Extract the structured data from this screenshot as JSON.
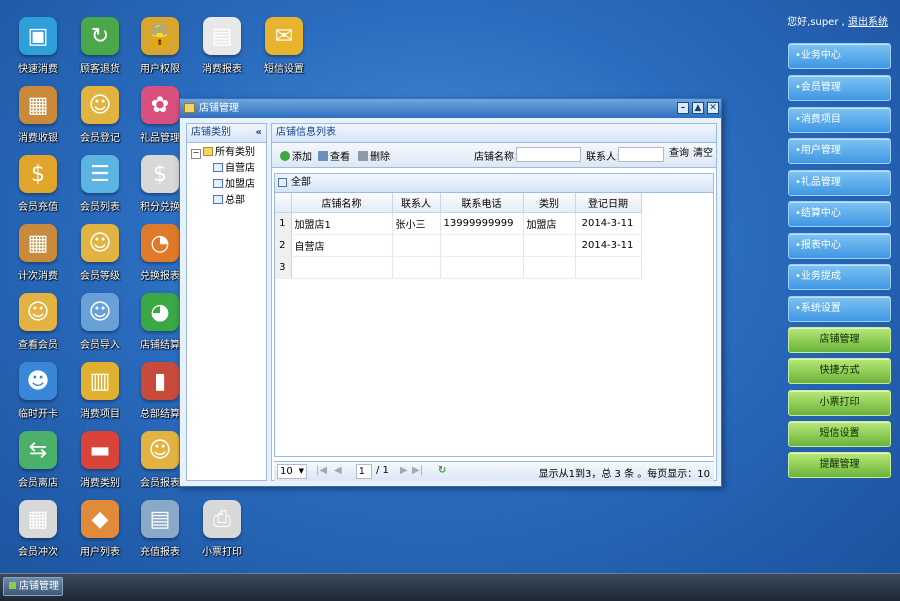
{
  "desktop": {
    "icons": [
      {
        "label": "快速消费",
        "icon": "fast-consume-icon",
        "glyph": "▣",
        "bg": "#2e9fd8"
      },
      {
        "label": "顾客退货",
        "icon": "return-goods-icon",
        "glyph": "↻",
        "bg": "#4aa84a"
      },
      {
        "label": "用户权限",
        "icon": "user-permission-icon",
        "glyph": "🔒",
        "bg": "#d9a531"
      },
      {
        "label": "消费报表",
        "icon": "consume-report-icon",
        "glyph": "▤",
        "bg": "#e8e8e8"
      },
      {
        "label": "短信设置",
        "icon": "sms-settings-icon",
        "glyph": "✉",
        "bg": "#e8b32d"
      },
      {
        "label": "消费收银",
        "icon": "cashier-icon",
        "glyph": "▦",
        "bg": "#c98a3b"
      },
      {
        "label": "会员登记",
        "icon": "member-register-icon",
        "glyph": "☺",
        "bg": "#e2b340"
      },
      {
        "label": "礼品管理",
        "icon": "gift-icon",
        "glyph": "✿",
        "bg": "#d94f7e"
      },
      {
        "label": "会员充值",
        "icon": "member-recharge-icon",
        "glyph": "$",
        "bg": "#e0a52a"
      },
      {
        "label": "会员列表",
        "icon": "member-list-icon",
        "glyph": "☰",
        "bg": "#5bb5e0"
      },
      {
        "label": "积分兑换",
        "icon": "points-exchange-icon",
        "glyph": "$",
        "bg": "#d8d8d8"
      },
      {
        "label": "计次消费",
        "icon": "count-consume-icon",
        "glyph": "▦",
        "bg": "#c98a3b"
      },
      {
        "label": "会员等级",
        "icon": "member-level-icon",
        "glyph": "☺",
        "bg": "#e2b340"
      },
      {
        "label": "兑换报表",
        "icon": "exchange-report-icon",
        "glyph": "◔",
        "bg": "#e07a2a"
      },
      {
        "label": "查看会员",
        "icon": "view-member-icon",
        "glyph": "☺",
        "bg": "#e2b340"
      },
      {
        "label": "会员导入",
        "icon": "member-import-icon",
        "glyph": "☺",
        "bg": "#6aa0d8"
      },
      {
        "label": "店铺结算",
        "icon": "store-settle-icon",
        "glyph": "◕",
        "bg": "#39a845"
      },
      {
        "label": "临时开卡",
        "icon": "temp-card-icon",
        "glyph": "☻",
        "bg": "#3a86d8"
      },
      {
        "label": "消费项目",
        "icon": "consume-item-icon",
        "glyph": "▥",
        "bg": "#e0b030"
      },
      {
        "label": "总部结算",
        "icon": "hq-settle-icon",
        "glyph": "▮",
        "bg": "#c84a3a"
      },
      {
        "label": "会员离店",
        "icon": "member-leave-icon",
        "glyph": "⇆",
        "bg": "#4ab06a"
      },
      {
        "label": "消费类别",
        "icon": "consume-category-icon",
        "glyph": "▬",
        "bg": "#d9433a"
      },
      {
        "label": "会员报表",
        "icon": "member-report-icon",
        "glyph": "☺",
        "bg": "#e2b340"
      },
      {
        "label": "会员冲次",
        "icon": "member-redo-icon",
        "glyph": "▦",
        "bg": "#d8d8d8"
      },
      {
        "label": "用户列表",
        "icon": "user-list-icon",
        "glyph": "◆",
        "bg": "#e08a3a"
      },
      {
        "label": "充值报表",
        "icon": "recharge-report-icon",
        "glyph": "▤",
        "bg": "#8aa8c8"
      },
      {
        "label": "小票打印",
        "icon": "printer-icon",
        "glyph": "⎙",
        "bg": "#d8d8d8"
      }
    ]
  },
  "greeting": {
    "text": "您好,super ,",
    "logout": "退出系统"
  },
  "right_nav": {
    "blue": [
      "•业务中心",
      "•会员管理",
      "•消费项目",
      "•用户管理",
      "•礼品管理",
      "•结算中心",
      "•报表中心",
      "•业务提成",
      "•系统设置"
    ],
    "green": [
      "店铺管理",
      "快捷方式",
      "小票打印",
      "短信设置",
      "提醒管理"
    ]
  },
  "taskbar": {
    "item": "店铺管理"
  },
  "window": {
    "title": "店铺管理",
    "left_panel": {
      "title": "店铺类别",
      "collapse": "«",
      "tree": {
        "root": "所有类别",
        "children": [
          "自营店",
          "加盟店",
          "总部"
        ]
      }
    },
    "main_panel": {
      "title": "店铺信息列表",
      "toolbar": {
        "add": "添加",
        "view": "查看",
        "delete": "删除",
        "name_label": "店铺名称：",
        "contact_label": "联系人：",
        "name_value": "",
        "contact_value": "",
        "query": "查询",
        "clear": "清空"
      },
      "grid": {
        "title": "全部",
        "columns": [
          "店铺名称",
          "联系人",
          "联系电话",
          "类别",
          "登记日期"
        ],
        "rows": [
          {
            "n": "1",
            "name": "加盟店1",
            "contact": "张小三",
            "phone": "13999999999",
            "type": "加盟店",
            "date": "2014-3-11"
          },
          {
            "n": "2",
            "name": "自营店",
            "contact": "",
            "phone": "",
            "type": "",
            "date": "2014-3-11"
          },
          {
            "n": "3",
            "name": "",
            "contact": "",
            "phone": "",
            "type": "",
            "date": ""
          }
        ]
      },
      "pager": {
        "page_size": "10",
        "page": "1",
        "total_pages": "/ 1",
        "summary": "显示从1到3，总 3 条 。每页显示：10"
      }
    }
  }
}
